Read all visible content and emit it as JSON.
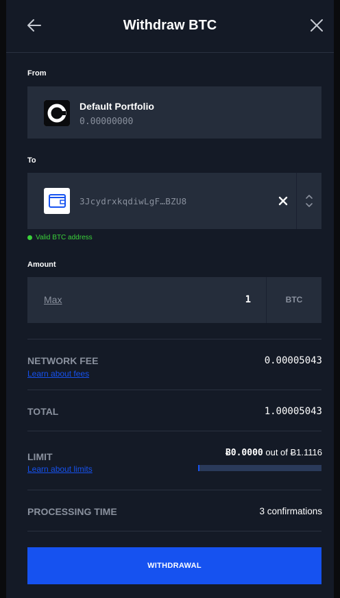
{
  "header": {
    "title": "Withdraw BTC",
    "back_icon": "arrow-left-icon",
    "close_icon": "close-icon"
  },
  "from": {
    "label": "From",
    "portfolio_name": "Default Portfolio",
    "balance": "0.00000000",
    "logo_icon": "coinbase-logo-icon"
  },
  "to": {
    "label": "To",
    "address": "3JcydrxkqdiwLgF…BZU8",
    "wallet_icon": "wallet-icon",
    "clear_icon": "close-icon",
    "select_icon": "chevron-updown-icon",
    "validation_text": "Valid BTC address"
  },
  "amount": {
    "label": "Amount",
    "max_label": "Max",
    "value": "1",
    "unit": "BTC"
  },
  "summary": {
    "network_fee_label": "NETWORK FEE",
    "network_fee_link": "Learn about fees",
    "network_fee_value": "0.00005043",
    "total_label": "TOTAL",
    "total_value": "1.00005043",
    "limit_label": "LIMIT",
    "limit_link": "Learn about limits",
    "limit_used": "Ƀ0.0000",
    "limit_out_of": "out of Ƀ1.1116",
    "limit_progress": 0.01,
    "processing_label": "PROCESSING TIME",
    "processing_value": "3 confirmations"
  },
  "actions": {
    "withdraw_label": "WITHDRAWAL"
  },
  "colors": {
    "accent": "#1652f0",
    "valid": "#3ad13a",
    "panel": "#141a26",
    "field": "#252d3b"
  }
}
